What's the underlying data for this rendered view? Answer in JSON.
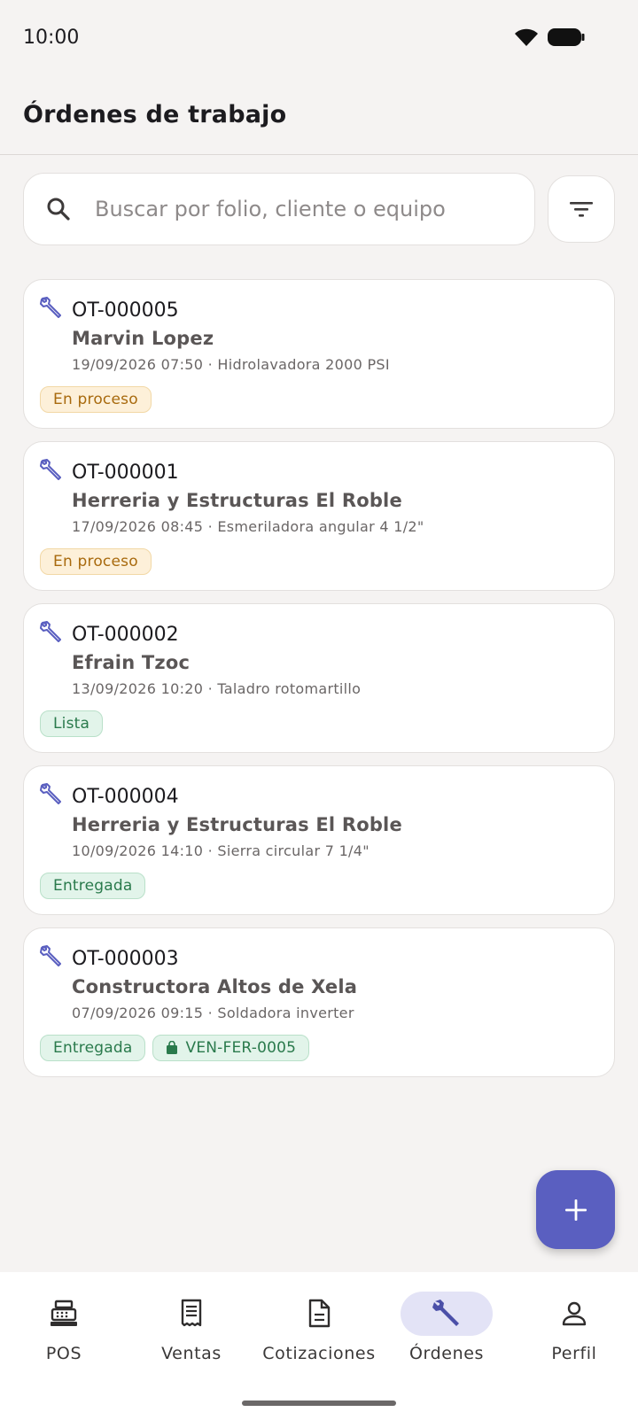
{
  "status_bar": {
    "time": "10:00"
  },
  "header": {
    "title": "Órdenes de trabajo"
  },
  "search": {
    "placeholder": "Buscar por folio, cliente o equipo"
  },
  "orders": [
    {
      "folio": "OT-000005",
      "client": "Marvin Lopez",
      "meta": "19/09/2026 07:50 · Hidrolavadora 2000 PSI",
      "status": "En proceso",
      "status_kind": "proceso",
      "sale": ""
    },
    {
      "folio": "OT-000001",
      "client": "Herreria y Estructuras El Roble",
      "meta": "17/09/2026 08:45 · Esmeriladora angular 4 1/2\"",
      "status": "En proceso",
      "status_kind": "proceso",
      "sale": ""
    },
    {
      "folio": "OT-000002",
      "client": "Efrain Tzoc",
      "meta": "13/09/2026 10:20 · Taladro rotomartillo",
      "status": "Lista",
      "status_kind": "lista",
      "sale": ""
    },
    {
      "folio": "OT-000004",
      "client": "Herreria y Estructuras El Roble",
      "meta": "10/09/2026 14:10 · Sierra circular 7 1/4\"",
      "status": "Entregada",
      "status_kind": "entregada",
      "sale": ""
    },
    {
      "folio": "OT-000003",
      "client": "Constructora Altos de Xela",
      "meta": "07/09/2026 09:15 · Soldadora inverter",
      "status": "Entregada",
      "status_kind": "entregada",
      "sale": "VEN-FER-0005"
    }
  ],
  "nav": {
    "items": [
      {
        "label": "POS",
        "icon": "cash-register-icon"
      },
      {
        "label": "Ventas",
        "icon": "receipt-icon"
      },
      {
        "label": "Cotizaciones",
        "icon": "document-icon"
      },
      {
        "label": "Órdenes",
        "icon": "wrench-icon",
        "active": true
      },
      {
        "label": "Perfil",
        "icon": "person-icon"
      }
    ]
  },
  "colors": {
    "accent": "#5a5fc0",
    "status_proceso": "#a86a0e",
    "status_lista": "#2a7a4c",
    "status_entregada": "#2a7a4c"
  }
}
